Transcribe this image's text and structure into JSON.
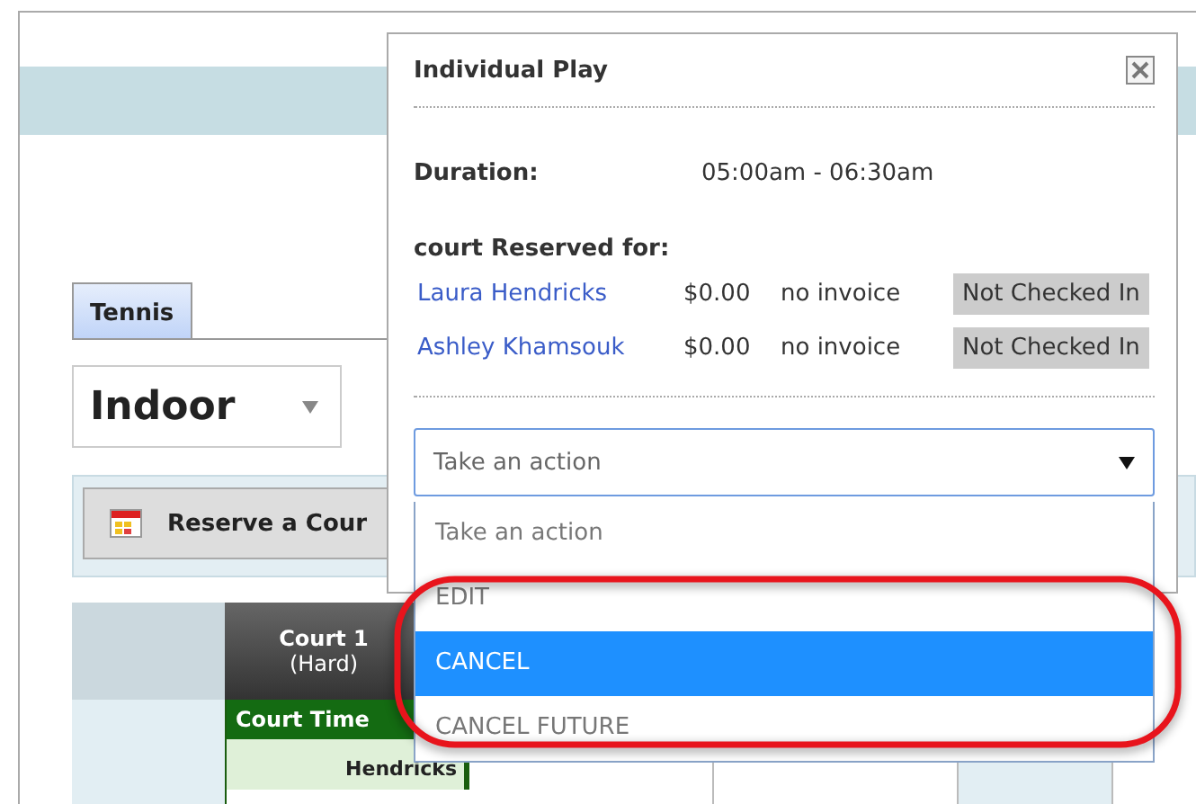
{
  "page": {
    "tabs": [
      {
        "label": "Tennis",
        "selected": true
      }
    ],
    "location_select": {
      "value": "Indoor"
    },
    "reserve_button": "Reserve a Cour",
    "schedule": {
      "court": "Court 1",
      "surface": "(Hard)",
      "column": "Court Time",
      "cell": "Hendricks"
    }
  },
  "popup": {
    "title": "Individual Play",
    "duration_label": "Duration:",
    "duration": "05:00am - 06:30am",
    "reserved_label": "court Reserved for:",
    "players": [
      {
        "name": "Laura Hendricks",
        "amount": "$0.00",
        "invoice": "no invoice",
        "status": "Not Checked In"
      },
      {
        "name": "Ashley Khamsouk",
        "amount": "$0.00",
        "invoice": "no invoice",
        "status": "Not Checked In"
      }
    ],
    "action_select": {
      "value": "Take an action"
    },
    "options": [
      {
        "label": "Take an action",
        "selected": false
      },
      {
        "label": "EDIT",
        "selected": false
      },
      {
        "label": "CANCEL",
        "selected": true
      },
      {
        "label": "CANCEL FUTURE",
        "selected": false
      }
    ]
  }
}
